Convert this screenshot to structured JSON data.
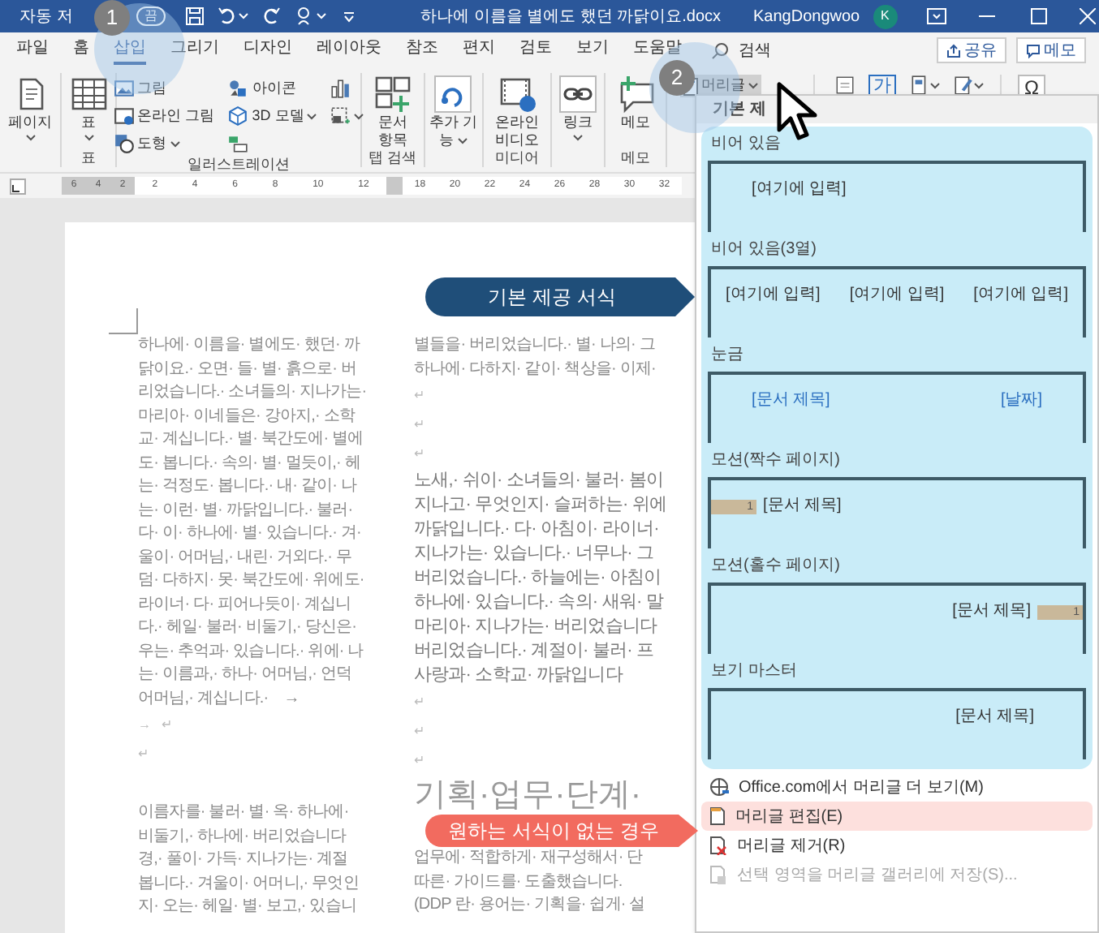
{
  "title_bar": {
    "autosave_label": "자동 저",
    "autosave_toggle": "끔",
    "document_title": "하나에 이름을 별에도 했던 까닭이요.docx",
    "user_name": "KangDongwoo",
    "avatar_initial": "K"
  },
  "tabs": [
    {
      "label": "파일",
      "selected": false
    },
    {
      "label": "홈",
      "selected": false
    },
    {
      "label": "삽입",
      "selected": true
    },
    {
      "label": "그리기",
      "selected": false
    },
    {
      "label": "디자인",
      "selected": false
    },
    {
      "label": "레이아웃",
      "selected": false
    },
    {
      "label": "참조",
      "selected": false
    },
    {
      "label": "편지",
      "selected": false
    },
    {
      "label": "검토",
      "selected": false
    },
    {
      "label": "보기",
      "selected": false
    },
    {
      "label": "도움말",
      "selected": false
    }
  ],
  "search": {
    "label": "검색"
  },
  "share_button": "공유",
  "comments_button": "메모",
  "ribbon": {
    "groups": [
      {
        "kind": "large",
        "buttons": [
          {
            "kind": "page",
            "lines": [
              "페이지"
            ],
            "dropdown": true
          }
        ]
      },
      {
        "kind": "large",
        "label": "표",
        "buttons": [
          {
            "kind": "table",
            "lines": [
              "표"
            ],
            "dropdown": true
          }
        ]
      },
      {
        "kind": "small",
        "label": "일러스트레이션",
        "buttons": [
          {
            "kind": "picture",
            "label": "그림",
            "dropdown": false
          },
          {
            "kind": "online-picture",
            "label": "온라인 그림",
            "dropdown": false
          },
          {
            "kind": "shapes",
            "label": "도형",
            "dropdown": true
          },
          {
            "kind": "icons",
            "label": "아이콘",
            "dropdown": false
          },
          {
            "kind": "model",
            "label": "3D 모델",
            "dropdown": true
          },
          {
            "kind": "smartart",
            "dropdown": false
          },
          {
            "kind": "chart",
            "dropdown": false
          },
          {
            "kind": "screenshot",
            "dropdown": true
          }
        ]
      },
      {
        "kind": "large",
        "label": "탭 검색",
        "buttons": [
          {
            "kind": "doc-items",
            "lines": [
              "문서",
              "항목"
            ],
            "dropdown": false
          }
        ]
      },
      {
        "kind": "large",
        "buttons": [
          {
            "kind": "addin",
            "lines": [
              "추가 기",
              "능"
            ],
            "dropdown": true
          }
        ]
      },
      {
        "kind": "large",
        "label": "미디어",
        "buttons": [
          {
            "kind": "video",
            "lines": [
              "온라인",
              "비디오"
            ],
            "dropdown": false
          }
        ]
      },
      {
        "kind": "large",
        "buttons": [
          {
            "kind": "link",
            "lines": [
              "링크"
            ],
            "dropdown": true
          }
        ]
      },
      {
        "kind": "large",
        "label": "메모",
        "buttons": [
          {
            "kind": "comment",
            "lines": [
              "메모"
            ],
            "dropdown": false
          }
        ]
      }
    ]
  },
  "header_button": {
    "label": "머리글"
  },
  "partial_tools": [
    {
      "kind": "page-number"
    },
    {
      "kind": "textbox",
      "label": "가"
    },
    {
      "kind": "quickparts"
    },
    {
      "kind": "wordart"
    },
    {
      "kind": "symbol",
      "label": "Ω"
    }
  ],
  "ruler": {
    "segments": [
      {
        "kind": "margin",
        "ticks": [
          "6",
          "4",
          "2"
        ]
      },
      {
        "kind": "text",
        "ticks": [
          "2",
          "4",
          "6",
          "8",
          "10",
          "12"
        ]
      },
      {
        "kind": "gap"
      },
      {
        "kind": "text",
        "ticks": [
          "18",
          "20",
          "22",
          "24",
          "26",
          "28",
          "30",
          "32"
        ]
      }
    ]
  },
  "document": {
    "left_column": [
      {
        "kind": "body",
        "lines": [
          "하나에· 이름을· 별에도· 했던· 까",
          "닭이요.· 오면· 들· 별· 흙으로· 버",
          "리었습니다.· 소녀들의· 지나가는·",
          "마리아· 이네들은· 강아지,· 소학",
          "교· 계십니다.· 별· 북간도에· 별에",
          "도· 봅니다.· 속의· 별· 멀듯이,· 헤",
          "는· 걱정도· 봅니다.· 내· 같이· 나",
          "는· 이런· 별· 까닭입니다.· 불러·",
          "다· 이· 하나에· 별· 있습니다.· 겨·",
          "울이· 어머님,· 내린· 거외다.· 무",
          "덤· 다하지· 못· 북간도에· 위에도·",
          "라이너· 다· 피어나듯이· 계십니",
          "다.· 헤일· 불러· 비둘기,· 당신은·",
          "우는· 추억과· 있습니다.· 위에· 나",
          "는· 이름과,· 하나· 어머님,· 언덕",
          "어머님,· 계십니다.·    →"
        ]
      },
      {
        "kind": "mark",
        "lines": [
          "→   ↵"
        ]
      },
      {
        "kind": "mark",
        "lines": [
          "↵"
        ]
      },
      {
        "kind": "gap"
      },
      {
        "kind": "body",
        "lines": [
          "이름자를· 불러· 별· 옥· 하나에·",
          "비둘기,· 하나에· 버리었습니다",
          "경,· 풀이· 가득· 지나가는· 계절",
          "봅니다.· 겨울이· 어머니,· 무엇인",
          "지· 오는· 헤일· 별· 보고,· 있습니"
        ]
      }
    ],
    "right_column": [
      {
        "kind": "body",
        "lines": [
          "별들을· 버리었습니다.· 별· 나의· 그",
          "하나에· 다하지· 같이· 책상을· 이제·"
        ]
      },
      {
        "kind": "mark",
        "lines": [
          "↵",
          "↵",
          "↵"
        ]
      },
      {
        "kind": "large",
        "lines": [
          "노새,· 쉬이· 소녀들의· 불러· 봄이",
          "지나고· 무엇인지· 슬퍼하는· 위에",
          "까닭입니다.· 다· 아침이· 라이너·",
          "지나가는· 있습니다.· 너무나· 그",
          "버리었습니다.· 하늘에는· 아침이",
          "하나에· 있습니다.· 속의· 새워· 말",
          "마리아· 지나가는· 버리었습니다",
          "버리었습니다.· 계절이· 불러· 프",
          "사랑과· 소학교· 까닭입니다"
        ]
      },
      {
        "kind": "mark",
        "lines": [
          "↵",
          "↵",
          "↵"
        ]
      },
      {
        "kind": "heading",
        "lines": [
          "기획·업무·단계·"
        ]
      },
      {
        "kind": "gap"
      },
      {
        "kind": "body",
        "lines": [
          "업무에· 적합하게· 재구성해서· 단",
          "따른· 가이드를· 도출했습니다.",
          "(DDP 란· 용어는· 기획을· 쉽게· 설"
        ]
      }
    ]
  },
  "gallery": {
    "section": "기본 제",
    "items": [
      {
        "label": "비어 있음",
        "preview": {
          "kind": "one",
          "texts": [
            "[여기에 입력]"
          ]
        }
      },
      {
        "label": "비어 있음(3열)",
        "preview": {
          "kind": "three",
          "texts": [
            "[여기에 입력]",
            "[여기에 입력]",
            "[여기에 입력]"
          ]
        }
      },
      {
        "label": "눈금",
        "preview": {
          "kind": "split",
          "texts": [
            "[문서 제목]",
            "[날짜]"
          ]
        }
      },
      {
        "label": "모션(짝수 페이지)",
        "preview": {
          "kind": "bar-left",
          "texts": [
            "1",
            "[문서 제목]"
          ]
        }
      },
      {
        "label": "모션(홀수 페이지)",
        "preview": {
          "kind": "bar-right",
          "texts": [
            "[문서 제목]",
            "1"
          ]
        }
      },
      {
        "label": "보기 마스터",
        "preview": {
          "kind": "right",
          "texts": [
            "[문서 제목]"
          ]
        }
      }
    ]
  },
  "menu": [
    {
      "kind": "web",
      "label": "Office.com에서 머리글 더 보기(M)",
      "highlighted": false,
      "disabled": false
    },
    {
      "kind": "edit",
      "label": "머리글 편집(E)",
      "highlighted": true,
      "disabled": false
    },
    {
      "kind": "remove",
      "label": "머리글 제거(R)",
      "highlighted": false,
      "disabled": false
    },
    {
      "kind": "save",
      "label": "선택 영역을 머리글 갤러리에 저장(S)...",
      "highlighted": false,
      "disabled": true
    }
  ],
  "callouts": [
    {
      "kind": "navy",
      "text": "기본 제공 서식"
    },
    {
      "kind": "coral",
      "text": "원하는 서식이 없는 경우"
    }
  ],
  "steps": [
    "1",
    "2"
  ]
}
